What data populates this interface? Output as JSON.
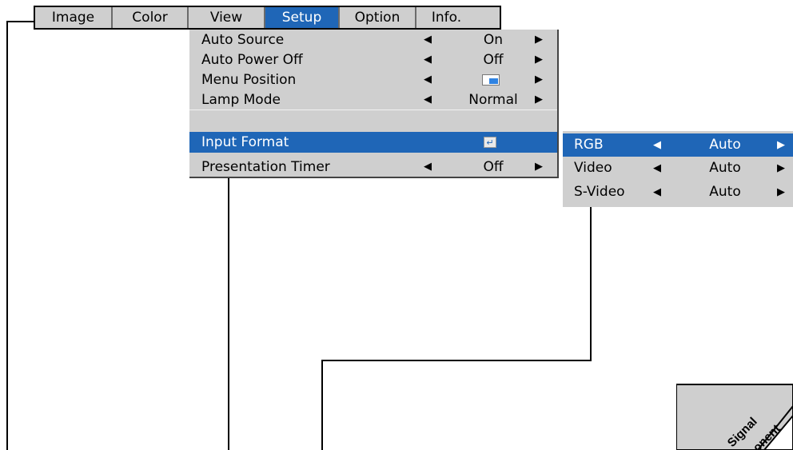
{
  "menubar": {
    "tabs": [
      {
        "label": "Image"
      },
      {
        "label": "Color"
      },
      {
        "label": "View"
      },
      {
        "label": "Setup"
      },
      {
        "label": "Option"
      },
      {
        "label": "Info."
      }
    ],
    "active_tab": "Setup"
  },
  "setup_menu": {
    "items": [
      {
        "label": "Auto Source",
        "value": "On"
      },
      {
        "label": "Auto Power Off",
        "value": "Off"
      },
      {
        "label": "Menu Position",
        "value_icon": "menu-position-icon"
      },
      {
        "label": "Lamp Mode",
        "value": "Normal"
      },
      {
        "label": "Input Format",
        "value_icon": "enter-icon"
      },
      {
        "label": "Presentation Timer",
        "value": "Off"
      }
    ]
  },
  "input_format_submenu": {
    "items": [
      {
        "label": "RGB",
        "value": "Auto"
      },
      {
        "label": "Video",
        "value": "Auto"
      },
      {
        "label": "S-Video",
        "value": "Auto"
      }
    ]
  },
  "arrows": {
    "left": "◀",
    "right": "▶"
  },
  "enter_glyph": "↵",
  "corner_labels": {
    "line1": "Signal",
    "line2": "onent"
  },
  "colors": {
    "menu_bg": "#cfcfcf",
    "selected_bg": "#1f66b7",
    "selected_text": "#ffffff"
  }
}
